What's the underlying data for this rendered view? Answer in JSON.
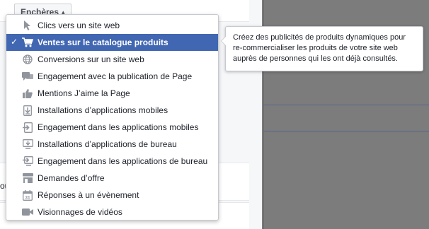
{
  "auction_button": {
    "label": "Enchères",
    "arrow": "▴"
  },
  "cut_text": "ou",
  "menu": {
    "items": [
      {
        "label": "Clics vers un site web",
        "icon": "cursor-icon",
        "selected": false
      },
      {
        "label": "Ventes sur le catalogue produits",
        "icon": "cart-icon",
        "selected": true
      },
      {
        "label": "Conversions sur un site web",
        "icon": "globe-icon",
        "selected": false
      },
      {
        "label": "Engagement avec la publication de Page",
        "icon": "speech-bubble-icon",
        "selected": false
      },
      {
        "label": "Mentions J’aime la Page",
        "icon": "thumbs-up-icon",
        "selected": false
      },
      {
        "label": "Installations d’applications mobiles",
        "icon": "mobile-download-icon",
        "selected": false
      },
      {
        "label": "Engagement dans les applications mobiles",
        "icon": "mobile-enter-icon",
        "selected": false
      },
      {
        "label": "Installations d’applications de bureau",
        "icon": "desktop-download-icon",
        "selected": false
      },
      {
        "label": "Engagement dans les applications de bureau",
        "icon": "desktop-enter-icon",
        "selected": false
      },
      {
        "label": "Demandes d’offre",
        "icon": "storefront-icon",
        "selected": false
      },
      {
        "label": "Réponses à un évènement",
        "icon": "calendar-icon",
        "selected": false
      },
      {
        "label": "Visionnages de vidéos",
        "icon": "video-camera-icon",
        "selected": false
      }
    ],
    "check_mark": "✓"
  },
  "tooltip": {
    "text": "Créez des publicités de produits dynamiques pour re-commercialiser les produits de votre site web auprès de personnes qui les ont déjà consultés."
  },
  "colors": {
    "selected_bg": "#4267b2",
    "icon_gray": "#90949c",
    "preview_bg": "#7c7c7c"
  }
}
